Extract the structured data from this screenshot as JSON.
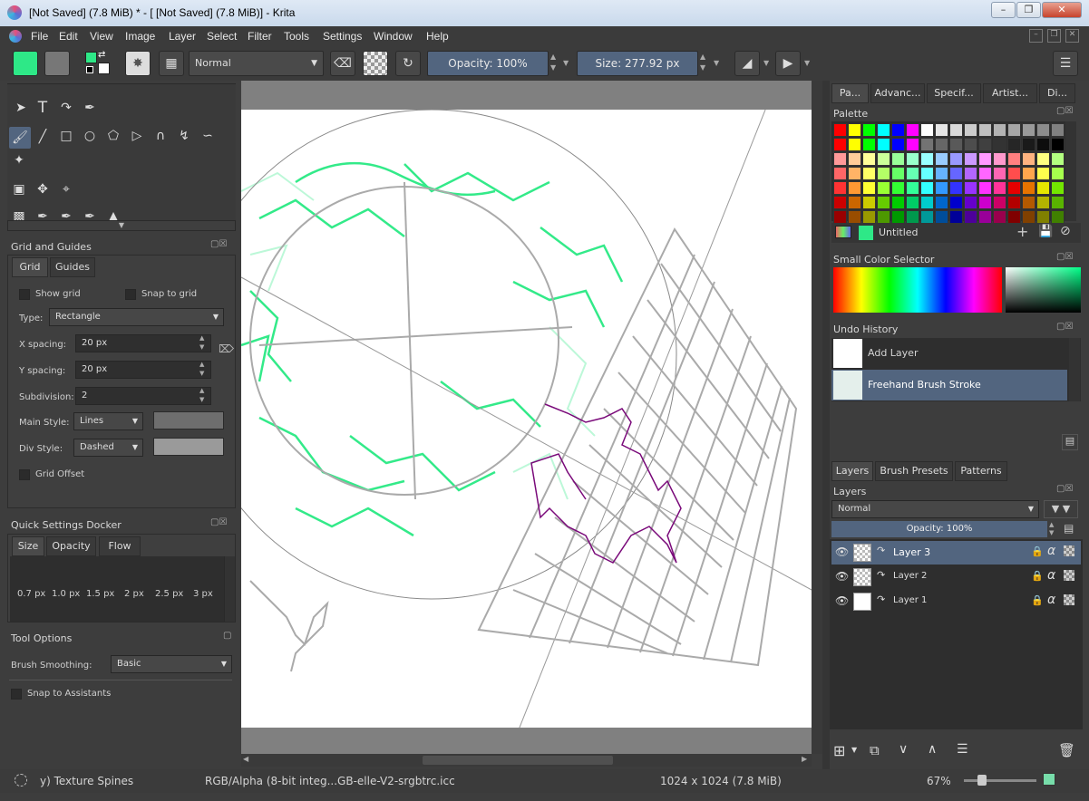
{
  "window": {
    "title": "[Not Saved]  (7.8 MiB) * - [ [Not Saved]  (7.8 MiB)] - Krita"
  },
  "menu": [
    "File",
    "Edit",
    "View",
    "Image",
    "Layer",
    "Select",
    "Filter",
    "Tools",
    "Settings",
    "Window",
    "Help"
  ],
  "toolbar": {
    "blend_mode": "Normal",
    "opacity_label": "Opacity:  100%",
    "size_label": "Size:  277.92 px"
  },
  "grid_guides": {
    "title": "Grid and Guides",
    "tabs": [
      "Grid",
      "Guides"
    ],
    "show_grid": "Show grid",
    "snap_to_grid": "Snap to grid",
    "type_label": "Type:",
    "type_value": "Rectangle",
    "x_spacing_label": "X spacing:",
    "x_spacing_value": "20 px",
    "y_spacing_label": "Y spacing:",
    "y_spacing_value": "20 px",
    "subdivision_label": "Subdivision:",
    "subdivision_value": "2",
    "main_style_label": "Main Style:",
    "main_style_value": "Lines",
    "div_style_label": "Div Style:",
    "div_style_value": "Dashed",
    "grid_offset": "Grid Offset"
  },
  "quick_settings": {
    "title": "Quick Settings Docker",
    "tabs": [
      "Size",
      "Opacity",
      "Flow"
    ],
    "sizes": [
      "0.7 px",
      "1.0 px",
      "1.5 px",
      "2 px",
      "2.5 px",
      "3 px"
    ]
  },
  "tool_options": {
    "title": "Tool Options",
    "smoothing_label": "Brush Smoothing:",
    "smoothing_value": "Basic",
    "snap_assistants": "Snap to Assistants"
  },
  "right_tabs": [
    "Pa...",
    "Advanc...",
    "Specif...",
    "Artist...",
    "Di..."
  ],
  "palette": {
    "title": "Palette",
    "name": "Untitled",
    "rows": [
      [
        "#ff0000",
        "#ffff00",
        "#00ff00",
        "#00ffff",
        "#0000ff",
        "#ff00ff",
        "#ffffff",
        "#e6e6e6",
        "#d9d9d9",
        "#cccccc",
        "#bfbfbf",
        "#b3b3b3",
        "#a6a6a6",
        "#999999",
        "#8c8c8c",
        "#808080"
      ],
      [
        "#ff0000",
        "#ffff00",
        "#00ff00",
        "#00ffff",
        "#0000ff",
        "#ff00ff",
        "#737373",
        "#666666",
        "#595959",
        "#4d4d4d",
        "#404040",
        "#333333",
        "#262626",
        "#1a1a1a",
        "#0d0d0d",
        "#000000"
      ],
      [
        "#ff9999",
        "#ffcc99",
        "#ffff99",
        "#ccff99",
        "#99ff99",
        "#99ffcc",
        "#99ffff",
        "#99ccff",
        "#9999ff",
        "#cc99ff",
        "#ff99ff",
        "#ff99cc",
        "#ff8080",
        "#ffb380",
        "#ffff80",
        "#b3ff80"
      ],
      [
        "#ff6666",
        "#ffb366",
        "#ffff66",
        "#b3ff66",
        "#66ff66",
        "#66ffb3",
        "#66ffff",
        "#66b3ff",
        "#6666ff",
        "#b366ff",
        "#ff66ff",
        "#ff66b3",
        "#ff4d4d",
        "#ffa64d",
        "#ffff4d",
        "#a6ff4d"
      ],
      [
        "#ff3333",
        "#ff9933",
        "#ffff33",
        "#99ff33",
        "#33ff33",
        "#33ff99",
        "#33ffff",
        "#3399ff",
        "#3333ff",
        "#9933ff",
        "#ff33ff",
        "#ff3399",
        "#e60000",
        "#e67300",
        "#e6e600",
        "#73e600"
      ],
      [
        "#cc0000",
        "#cc6600",
        "#cccc00",
        "#66cc00",
        "#00cc00",
        "#00cc66",
        "#00cccc",
        "#0066cc",
        "#0000cc",
        "#6600cc",
        "#cc00cc",
        "#cc0066",
        "#b30000",
        "#b35900",
        "#b3b300",
        "#59b300"
      ],
      [
        "#990000",
        "#994d00",
        "#999900",
        "#4d9900",
        "#009900",
        "#00994d",
        "#009999",
        "#004d99",
        "#000099",
        "#4d0099",
        "#990099",
        "#99004d",
        "#800000",
        "#804000",
        "#808000",
        "#408000"
      ]
    ]
  },
  "small_color_selector": {
    "title": "Small Color Selector"
  },
  "undo_history": {
    "title": "Undo History",
    "items": [
      "Add Layer",
      "Freehand Brush Stroke"
    ]
  },
  "layers_tabs": [
    "Layers",
    "Brush Presets",
    "Patterns"
  ],
  "layers": {
    "title": "Layers",
    "blend_mode": "Normal",
    "opacity_label": "Opacity:  100%",
    "items": [
      "Layer 3",
      "Layer 2",
      "Layer 1"
    ]
  },
  "status": {
    "brush": "y) Texture Spines",
    "color_space": "RGB/Alpha (8-bit integ...GB-elle-V2-srgbtrc.icc",
    "dimensions": "1024 x 1024 (7.8 MiB)",
    "zoom": "67%"
  },
  "colors": {
    "foreground": "#2ee887",
    "accent": "#52657f"
  }
}
